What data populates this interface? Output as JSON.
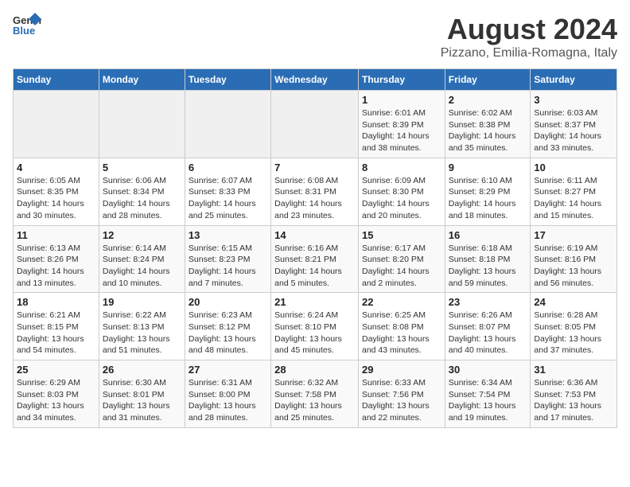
{
  "header": {
    "logo_line1": "General",
    "logo_line2": "Blue",
    "title": "August 2024",
    "subtitle": "Pizzano, Emilia-Romagna, Italy"
  },
  "weekdays": [
    "Sunday",
    "Monday",
    "Tuesday",
    "Wednesday",
    "Thursday",
    "Friday",
    "Saturday"
  ],
  "weeks": [
    [
      {
        "day": "",
        "info": ""
      },
      {
        "day": "",
        "info": ""
      },
      {
        "day": "",
        "info": ""
      },
      {
        "day": "",
        "info": ""
      },
      {
        "day": "1",
        "info": "Sunrise: 6:01 AM\nSunset: 8:39 PM\nDaylight: 14 hours\nand 38 minutes."
      },
      {
        "day": "2",
        "info": "Sunrise: 6:02 AM\nSunset: 8:38 PM\nDaylight: 14 hours\nand 35 minutes."
      },
      {
        "day": "3",
        "info": "Sunrise: 6:03 AM\nSunset: 8:37 PM\nDaylight: 14 hours\nand 33 minutes."
      }
    ],
    [
      {
        "day": "4",
        "info": "Sunrise: 6:05 AM\nSunset: 8:35 PM\nDaylight: 14 hours\nand 30 minutes."
      },
      {
        "day": "5",
        "info": "Sunrise: 6:06 AM\nSunset: 8:34 PM\nDaylight: 14 hours\nand 28 minutes."
      },
      {
        "day": "6",
        "info": "Sunrise: 6:07 AM\nSunset: 8:33 PM\nDaylight: 14 hours\nand 25 minutes."
      },
      {
        "day": "7",
        "info": "Sunrise: 6:08 AM\nSunset: 8:31 PM\nDaylight: 14 hours\nand 23 minutes."
      },
      {
        "day": "8",
        "info": "Sunrise: 6:09 AM\nSunset: 8:30 PM\nDaylight: 14 hours\nand 20 minutes."
      },
      {
        "day": "9",
        "info": "Sunrise: 6:10 AM\nSunset: 8:29 PM\nDaylight: 14 hours\nand 18 minutes."
      },
      {
        "day": "10",
        "info": "Sunrise: 6:11 AM\nSunset: 8:27 PM\nDaylight: 14 hours\nand 15 minutes."
      }
    ],
    [
      {
        "day": "11",
        "info": "Sunrise: 6:13 AM\nSunset: 8:26 PM\nDaylight: 14 hours\nand 13 minutes."
      },
      {
        "day": "12",
        "info": "Sunrise: 6:14 AM\nSunset: 8:24 PM\nDaylight: 14 hours\nand 10 minutes."
      },
      {
        "day": "13",
        "info": "Sunrise: 6:15 AM\nSunset: 8:23 PM\nDaylight: 14 hours\nand 7 minutes."
      },
      {
        "day": "14",
        "info": "Sunrise: 6:16 AM\nSunset: 8:21 PM\nDaylight: 14 hours\nand 5 minutes."
      },
      {
        "day": "15",
        "info": "Sunrise: 6:17 AM\nSunset: 8:20 PM\nDaylight: 14 hours\nand 2 minutes."
      },
      {
        "day": "16",
        "info": "Sunrise: 6:18 AM\nSunset: 8:18 PM\nDaylight: 13 hours\nand 59 minutes."
      },
      {
        "day": "17",
        "info": "Sunrise: 6:19 AM\nSunset: 8:16 PM\nDaylight: 13 hours\nand 56 minutes."
      }
    ],
    [
      {
        "day": "18",
        "info": "Sunrise: 6:21 AM\nSunset: 8:15 PM\nDaylight: 13 hours\nand 54 minutes."
      },
      {
        "day": "19",
        "info": "Sunrise: 6:22 AM\nSunset: 8:13 PM\nDaylight: 13 hours\nand 51 minutes."
      },
      {
        "day": "20",
        "info": "Sunrise: 6:23 AM\nSunset: 8:12 PM\nDaylight: 13 hours\nand 48 minutes."
      },
      {
        "day": "21",
        "info": "Sunrise: 6:24 AM\nSunset: 8:10 PM\nDaylight: 13 hours\nand 45 minutes."
      },
      {
        "day": "22",
        "info": "Sunrise: 6:25 AM\nSunset: 8:08 PM\nDaylight: 13 hours\nand 43 minutes."
      },
      {
        "day": "23",
        "info": "Sunrise: 6:26 AM\nSunset: 8:07 PM\nDaylight: 13 hours\nand 40 minutes."
      },
      {
        "day": "24",
        "info": "Sunrise: 6:28 AM\nSunset: 8:05 PM\nDaylight: 13 hours\nand 37 minutes."
      }
    ],
    [
      {
        "day": "25",
        "info": "Sunrise: 6:29 AM\nSunset: 8:03 PM\nDaylight: 13 hours\nand 34 minutes."
      },
      {
        "day": "26",
        "info": "Sunrise: 6:30 AM\nSunset: 8:01 PM\nDaylight: 13 hours\nand 31 minutes."
      },
      {
        "day": "27",
        "info": "Sunrise: 6:31 AM\nSunset: 8:00 PM\nDaylight: 13 hours\nand 28 minutes."
      },
      {
        "day": "28",
        "info": "Sunrise: 6:32 AM\nSunset: 7:58 PM\nDaylight: 13 hours\nand 25 minutes."
      },
      {
        "day": "29",
        "info": "Sunrise: 6:33 AM\nSunset: 7:56 PM\nDaylight: 13 hours\nand 22 minutes."
      },
      {
        "day": "30",
        "info": "Sunrise: 6:34 AM\nSunset: 7:54 PM\nDaylight: 13 hours\nand 19 minutes."
      },
      {
        "day": "31",
        "info": "Sunrise: 6:36 AM\nSunset: 7:53 PM\nDaylight: 13 hours\nand 17 minutes."
      }
    ]
  ]
}
